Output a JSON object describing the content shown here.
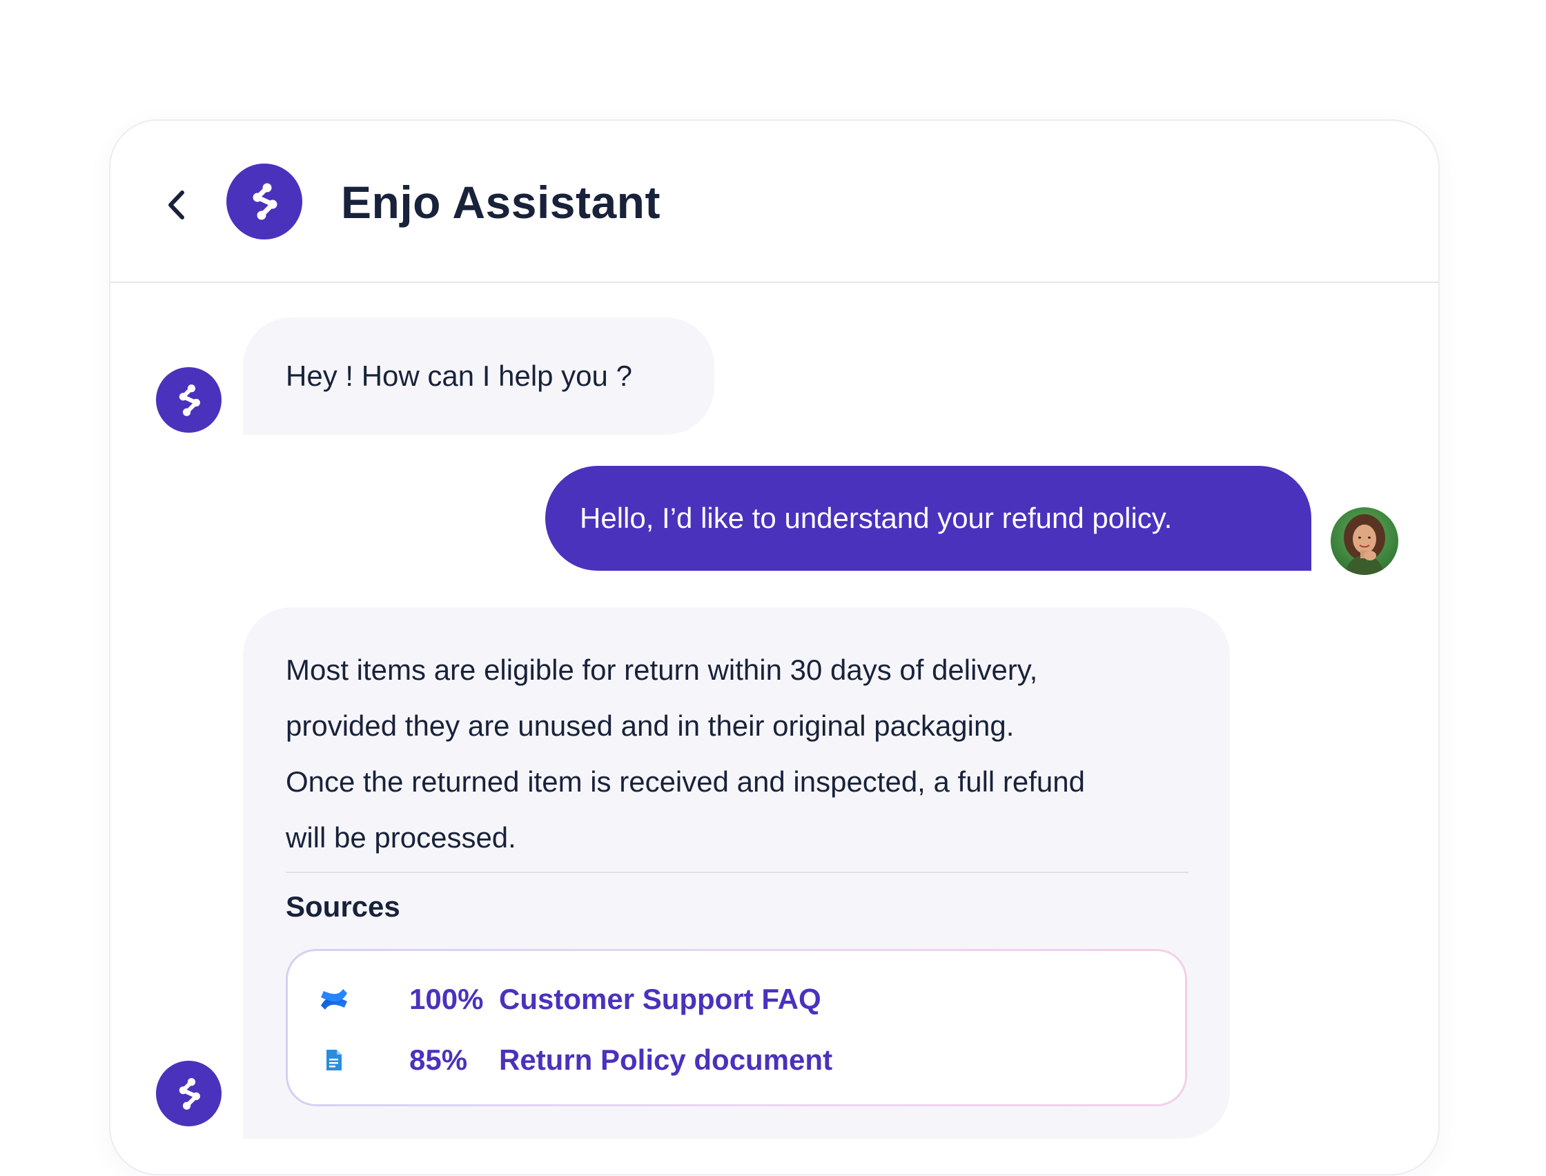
{
  "header": {
    "title": "Enjo Assistant",
    "back_icon": "chevron-left-icon",
    "logo_icon": "enjo-logo-icon"
  },
  "messages": {
    "greeting": "Hey ! How can I help you ?",
    "user_question": "Hello, I’d like to understand your refund policy.",
    "answer_lines": [
      "Most items are eligible for return within 30 days of delivery,",
      "provided they are unused and in their original packaging.",
      "Once the returned item is received and inspected, a full refund",
      "will be processed."
    ]
  },
  "sources": {
    "heading": "Sources",
    "items": [
      {
        "percent": "100%",
        "name": "Customer Support FAQ",
        "icon": "confluence-icon"
      },
      {
        "percent": "85%",
        "name": "Return Policy document",
        "icon": "document-icon"
      }
    ]
  },
  "colors": {
    "brand": "#4a32bd",
    "bot_bubble": "#f6f6fa",
    "text": "#18223a"
  }
}
